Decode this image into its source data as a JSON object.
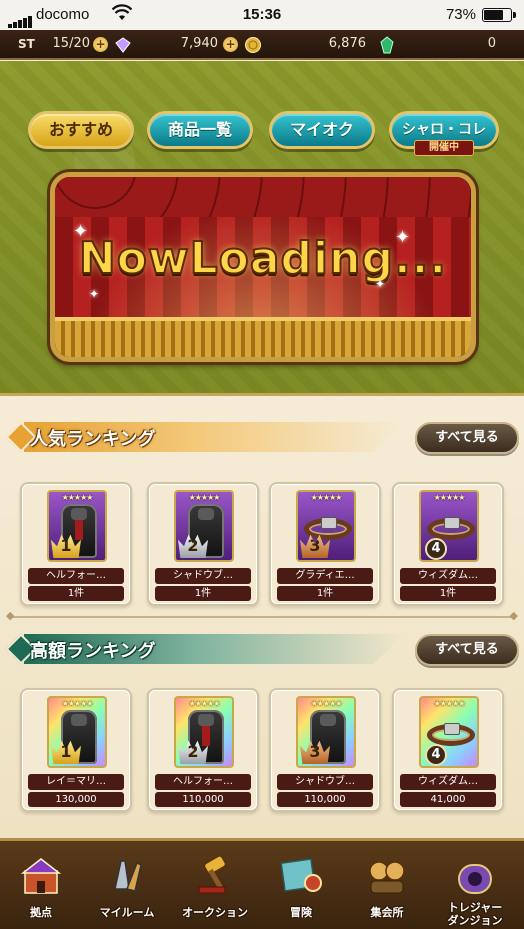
{
  "status_bar": {
    "carrier": "docomo",
    "time": "15:36",
    "battery_pct": "73%",
    "battery_level": 0.73
  },
  "currency": {
    "st_label": "ST",
    "stamina": "15/20",
    "crystal": "7,940",
    "gold": "6,876",
    "emerald": "0"
  },
  "tabs": [
    {
      "label": "おすすめ",
      "active": true
    },
    {
      "label": "商品一覧",
      "active": false
    },
    {
      "label": "マイオク",
      "active": false
    },
    {
      "label": "シャロ・コレ",
      "active": false,
      "badge": "開催中"
    }
  ],
  "banner": {
    "text": "NowLoading..."
  },
  "popular_ranking": {
    "title": "人気ランキング",
    "see_all": "すべて見る",
    "items": [
      {
        "rank": "1",
        "name": "ヘルフォー…",
        "count": "1件",
        "image": "armor-red",
        "medal": "gold"
      },
      {
        "rank": "2",
        "name": "シャドウブ…",
        "count": "1件",
        "image": "armor-dark",
        "medal": "silver"
      },
      {
        "rank": "3",
        "name": "グラディエ…",
        "count": "1件",
        "image": "belt",
        "medal": "bronze"
      },
      {
        "rank": "4",
        "name": "ウィズダム…",
        "count": "1件",
        "image": "belt",
        "medal": "circle"
      }
    ]
  },
  "price_ranking": {
    "title": "高額ランキング",
    "see_all": "すべて見る",
    "items": [
      {
        "rank": "1",
        "name": "レイ＝マリ…",
        "count": "130,000",
        "image": "armor-dark",
        "medal": "gold"
      },
      {
        "rank": "2",
        "name": "ヘルフォー…",
        "count": "110,000",
        "image": "armor-red",
        "medal": "silver"
      },
      {
        "rank": "3",
        "name": "シャドウブ…",
        "count": "110,000",
        "image": "armor-dark",
        "medal": "bronze"
      },
      {
        "rank": "4",
        "name": "ウィズダム…",
        "count": "41,000",
        "image": "belt",
        "medal": "circle"
      }
    ]
  },
  "bottom_nav": [
    {
      "label": "拠点",
      "icon": "base-icon"
    },
    {
      "label": "マイルーム",
      "icon": "myroom-icon"
    },
    {
      "label": "オークション",
      "icon": "auction-icon"
    },
    {
      "label": "冒険",
      "icon": "adventure-icon"
    },
    {
      "label": "集会所",
      "icon": "gathering-icon"
    },
    {
      "label": "トレジャー\nダンジョン",
      "icon": "treasure-dungeon-icon"
    }
  ],
  "colors": {
    "accent_gold": "#d8a318",
    "tab_teal": "#0b7a8a",
    "ribbon_orange": "#e7a234",
    "ribbon_green": "#1f6a54",
    "label_bg": "#4a1a14"
  }
}
